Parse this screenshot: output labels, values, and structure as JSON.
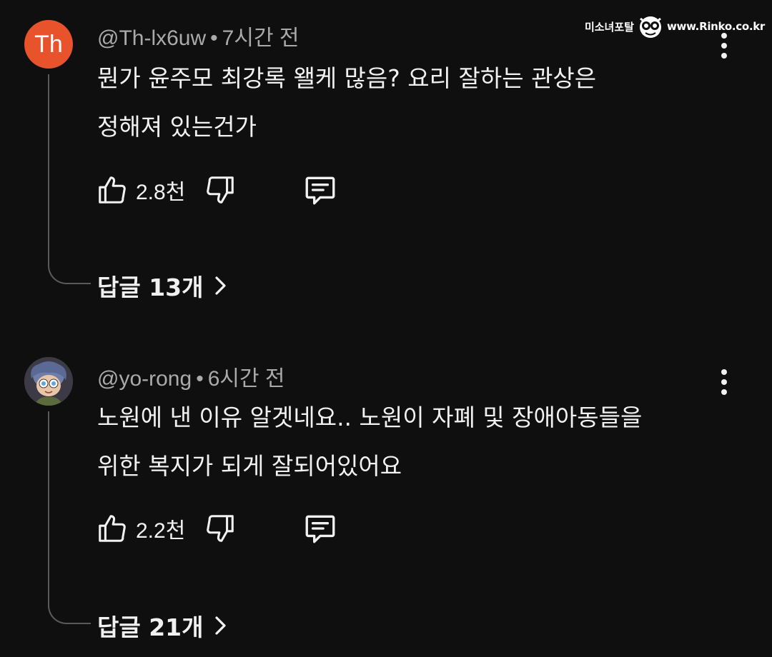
{
  "watermark": {
    "brand": "미소녀포탈",
    "site": "www.Rinko.co.kr"
  },
  "comments": [
    {
      "avatar_letter": "Th",
      "avatar_color": "#e8532c",
      "author": "@Th-lx6uw",
      "time": "7시간 전",
      "text_lines": [
        "뭔가 윤주모 최강록 왤케 많음? 요리 잘하는 관상은",
        "정해져 있는건가"
      ],
      "likes": "2.8천",
      "replies": "답글 13개"
    },
    {
      "avatar_icon": "cartoon-character-avatar",
      "author": "@yo-rong",
      "time": "6시간 전",
      "text_lines": [
        "노원에 낸 이유 알겟네요.. 노원이 자폐 및 장애아동들을",
        "위한 복지가 되게 잘되어있어요"
      ],
      "likes": "2.2천",
      "replies": "답글 21개"
    }
  ],
  "icons": {
    "like": "thumbs-up-icon",
    "dislike": "thumbs-down-icon",
    "reply": "comment-bubble-icon",
    "more": "more-vertical-icon",
    "chevron": "chevron-right-icon"
  }
}
